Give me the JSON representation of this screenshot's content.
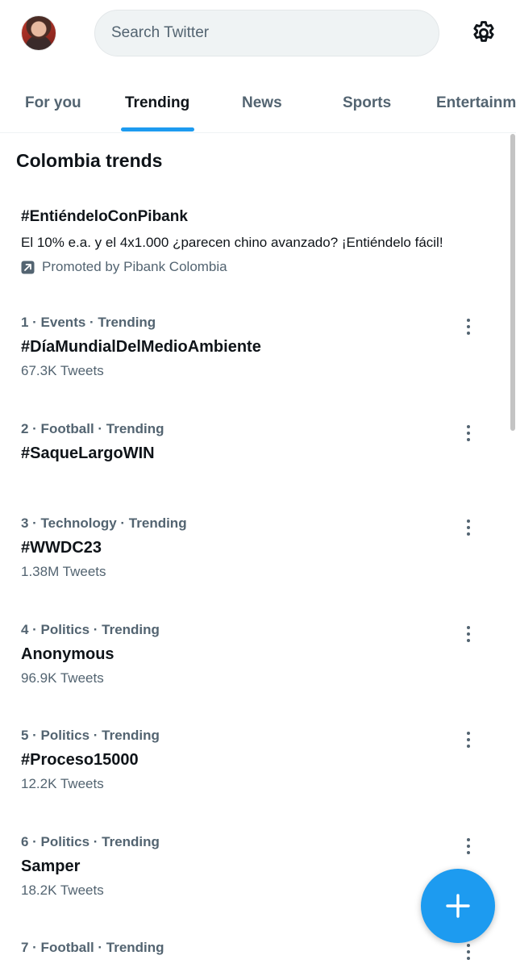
{
  "search": {
    "placeholder": "Search Twitter"
  },
  "tabs": [
    {
      "label": "For you"
    },
    {
      "label": "Trending"
    },
    {
      "label": "News"
    },
    {
      "label": "Sports"
    },
    {
      "label": "Entertainment"
    }
  ],
  "active_tab": "Trending",
  "section_title": "Colombia trends",
  "promoted": {
    "hashtag": "#EntiéndeloConPibank",
    "description": "El 10% e.a. y el 4x1.000 ¿parecen chino avanzado? ¡Entiéndelo fácil!",
    "promoted_by": "Promoted by Pibank Colombia"
  },
  "trends": [
    {
      "meta": "1 · Events · Trending",
      "name": "#DíaMundialDelMedioAmbiente",
      "count": "67.3K Tweets"
    },
    {
      "meta": "2 · Football · Trending",
      "name": "#SaqueLargoWIN",
      "count": ""
    },
    {
      "meta": "3 · Technology · Trending",
      "name": "#WWDC23",
      "count": "1.38M Tweets"
    },
    {
      "meta": "4 · Politics · Trending",
      "name": "Anonymous",
      "count": "96.9K Tweets"
    },
    {
      "meta": "5 · Politics · Trending",
      "name": "#Proceso15000",
      "count": "12.2K Tweets"
    },
    {
      "meta": "6 · Politics · Trending",
      "name": "Samper",
      "count": "18.2K Tweets"
    },
    {
      "meta": "7 · Football · Trending",
      "name": "",
      "count": ""
    }
  ],
  "icons": {
    "settings": "gear-icon",
    "more": "more-options-icon",
    "promoted": "promoted-arrow-icon",
    "compose": "plus-icon"
  },
  "colors": {
    "accent": "#1d9bf0",
    "secondary_text": "#536471",
    "primary_text": "#0f1419"
  }
}
